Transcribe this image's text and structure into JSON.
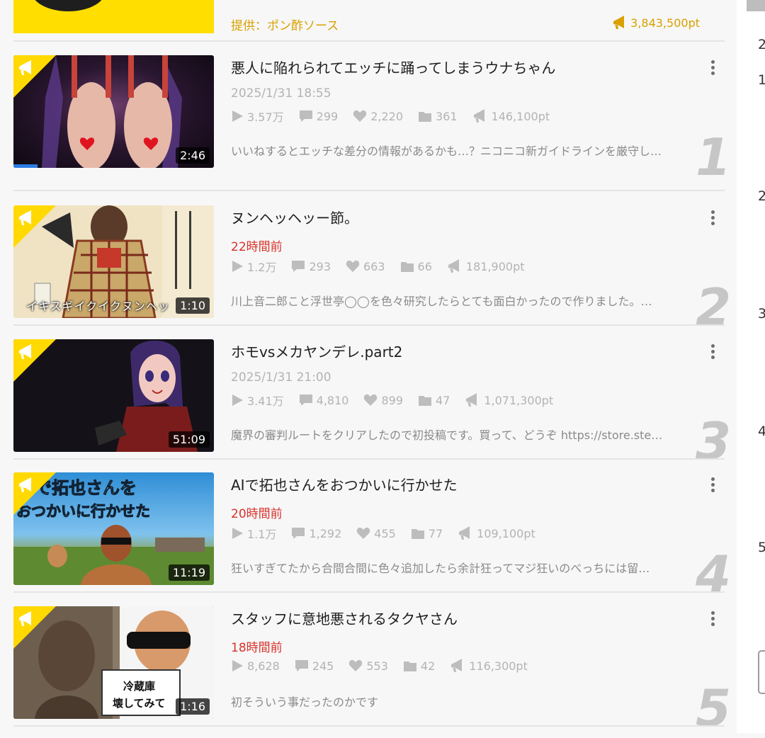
{
  "sponsor": {
    "label": "提供：ポン酢ソース",
    "points": "3,843,500pt"
  },
  "colors": {
    "accent": "#ffd900",
    "recent_date": "#d8322a",
    "sponsor_text": "#d9a000",
    "progress": "#2b7be4"
  },
  "items": [
    {
      "title": "悪人に陥れられてエッチに踊ってしまうウナちゃん",
      "date": "2025/1/31 18:55",
      "views": "3.57万",
      "comments": "299",
      "likes": "2,220",
      "mylists": "361",
      "points": "146,100pt",
      "description": "いいねするとエッチな差分の情報があるかも…？ニコニコ新ガイドラインを厳守し…",
      "duration": "2:46",
      "rank": "1",
      "progress_fraction": 0.12
    },
    {
      "title": "ヌンヘッヘッー節。",
      "date": "22時間前",
      "views": "1.2万",
      "comments": "293",
      "likes": "663",
      "mylists": "66",
      "points": "181,900pt",
      "description": "川上音二郎こと浮世亭◯◯を色々研究したらとても面白かったので作りました。…",
      "duration": "1:10",
      "rank": "2",
      "thumb_caption": "イキスギイクイクヌンヘッ"
    },
    {
      "title": "ホモvsメカヤンデレ.part2",
      "date": "2025/1/31 21:00",
      "views": "3.41万",
      "comments": "4,810",
      "likes": "899",
      "mylists": "47",
      "points": "1,071,300pt",
      "description": "魔界の審判ルートをクリアしたので初投稿です。買って、どうぞ https://store.ste…",
      "duration": "51:09",
      "rank": "3"
    },
    {
      "title": "AIで拓也さんをおつかいに行かせた",
      "date": "20時間前",
      "views": "1.1万",
      "comments": "1,292",
      "likes": "455",
      "mylists": "77",
      "points": "109,100pt",
      "description": "狂いすぎてたから合間合間に色々追加したら余計狂ってマジ狂いのべっちには留…",
      "duration": "11:19",
      "rank": "4",
      "thumb_text_1": "で拓也さんを",
      "thumb_text_2": "おつかいに行かせた"
    },
    {
      "title": "スタッフに意地悪されるタクヤさん",
      "date": "18時間前",
      "views": "8,628",
      "comments": "245",
      "likes": "553",
      "mylists": "42",
      "points": "116,300pt",
      "description": "初そういう事だったのかです",
      "duration": "1:16",
      "rank": "5",
      "thumb_sign_1": "冷蔵庫",
      "thumb_sign_2": "壊してみて"
    }
  ],
  "side_panel": {
    "digits": [
      "2",
      "1",
      "2",
      "3",
      "4",
      "5"
    ]
  },
  "icons": [
    "play-icon",
    "comment-icon",
    "heart-icon",
    "folder-icon",
    "megaphone-icon",
    "more-vertical-icon"
  ]
}
